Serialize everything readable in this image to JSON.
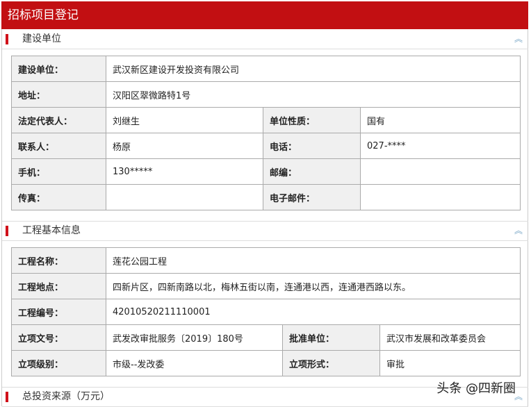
{
  "title": "招标项目登记",
  "sections": [
    "建设单位",
    "工程基本信息",
    "总投资来源（万元）"
  ],
  "unit": {
    "builder_label": "建设单位：",
    "builder": "武汉新区建设开发投资有限公司",
    "address_label": "地址：",
    "address": "汉阳区翠微路特1号",
    "legal_label": "法定代表人：",
    "legal": "刘继生",
    "nature_label": "单位性质：",
    "nature": "国有",
    "contact_label": "联系人：",
    "contact": "杨原",
    "phone_label": "电话：",
    "phone": "027-****",
    "mobile_label": "手机：",
    "mobile": "130*****",
    "postcode_label": "邮编：",
    "postcode": "",
    "fax_label": "传真：",
    "fax": "",
    "email_label": "电子邮件：",
    "email": ""
  },
  "project": {
    "name_label": "工程名称：",
    "name": "莲花公园工程",
    "location_label": "工程地点：",
    "location": "四新片区，四新南路以北，梅林五街以南，连通港以西，连通港西路以东。",
    "code_label": "工程编号：",
    "code": "42010520211110001",
    "doc_label": "立项文号：",
    "doc": "武发改审批服务〔2019〕180号",
    "approver_label": "批准单位：",
    "approver": "武汉市发展和改革委员会",
    "level_label": "立项级别：",
    "level": "市级--发改委",
    "form_label": "立项形式：",
    "form": "审批"
  },
  "watermark": "头条 @四新圈"
}
